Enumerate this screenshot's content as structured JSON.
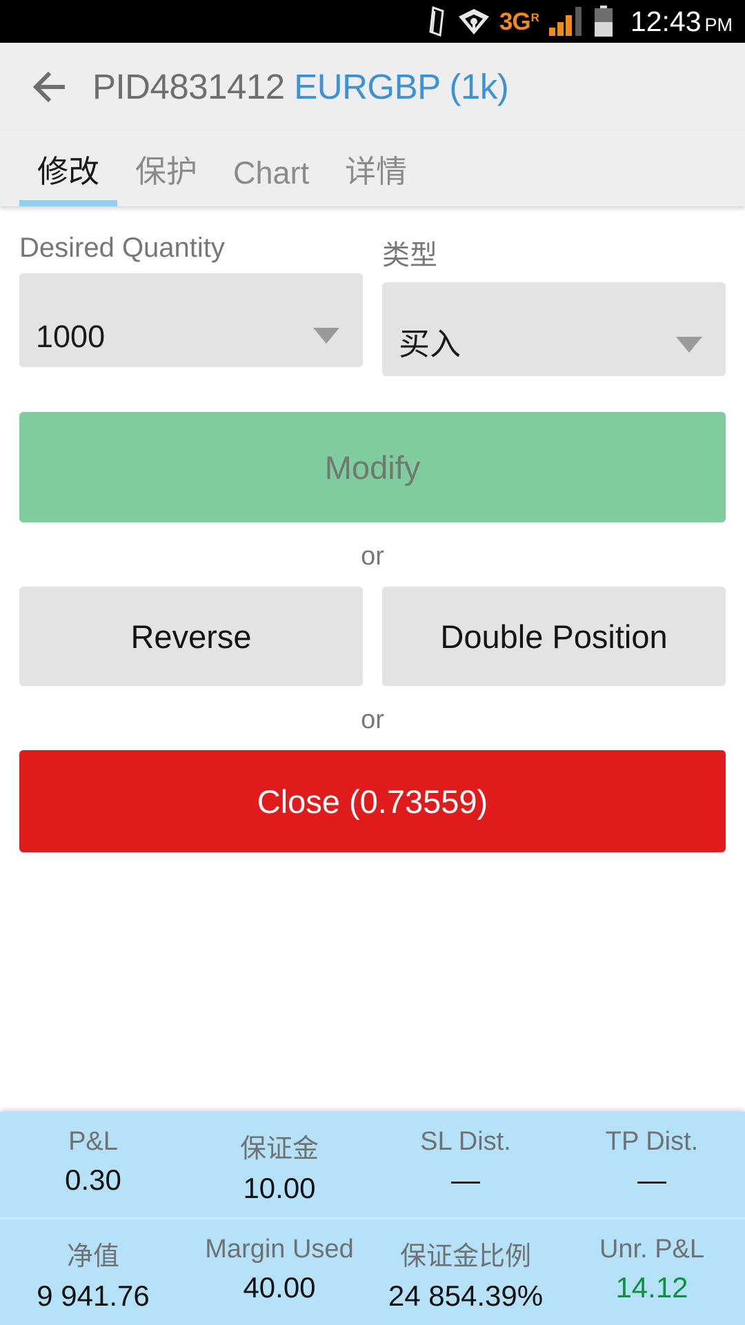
{
  "statusbar": {
    "icons": [
      "rotation-lock-icon",
      "wifi-icon",
      "signal-icon",
      "battery-icon"
    ],
    "network": "3G",
    "roaming": "R",
    "time": "12:43",
    "ampm": "PM"
  },
  "appbar": {
    "back_icon": "back-arrow-icon",
    "position_id": "PID4831412",
    "symbol": "EURGBP (1k)",
    "symbol_color": "#3b92d4"
  },
  "tabs": [
    {
      "label": "修改",
      "active": true
    },
    {
      "label": "保护",
      "active": false
    },
    {
      "label": "Chart",
      "active": false
    },
    {
      "label": "详情",
      "active": false
    }
  ],
  "form": {
    "quantity": {
      "label": "Desired Quantity",
      "value": "1000",
      "caret_icon": "chevron-down-icon"
    },
    "type": {
      "label": "类型",
      "value": "买入",
      "caret_icon": "chevron-down-icon"
    }
  },
  "actions": {
    "modify_label": "Modify",
    "or_1": "or",
    "reverse_label": "Reverse",
    "double_position_label": "Double Position",
    "or_2": "or",
    "close_label": "Close (0.73559)"
  },
  "colors": {
    "modify_green": "#7fcc9f",
    "close_red": "#e01b1b",
    "panel_blue": "#b5e2f8",
    "tab_indicator": "#8ed0f0",
    "profit_green": "#0d9140"
  },
  "info_panel": {
    "row1": [
      {
        "label": "P&L",
        "value": "0.30"
      },
      {
        "label": "保证金",
        "value": "10.00"
      },
      {
        "label": "SL Dist.",
        "value": "—"
      },
      {
        "label": "TP Dist.",
        "value": "—"
      }
    ],
    "row2": [
      {
        "label": "净值",
        "value": "9 941.76"
      },
      {
        "label": "Margin Used",
        "value": "40.00"
      },
      {
        "label": "保证金比例",
        "value": "24 854.39%"
      },
      {
        "label": "Unr. P&L",
        "value": "14.12",
        "positive": true
      }
    ]
  }
}
